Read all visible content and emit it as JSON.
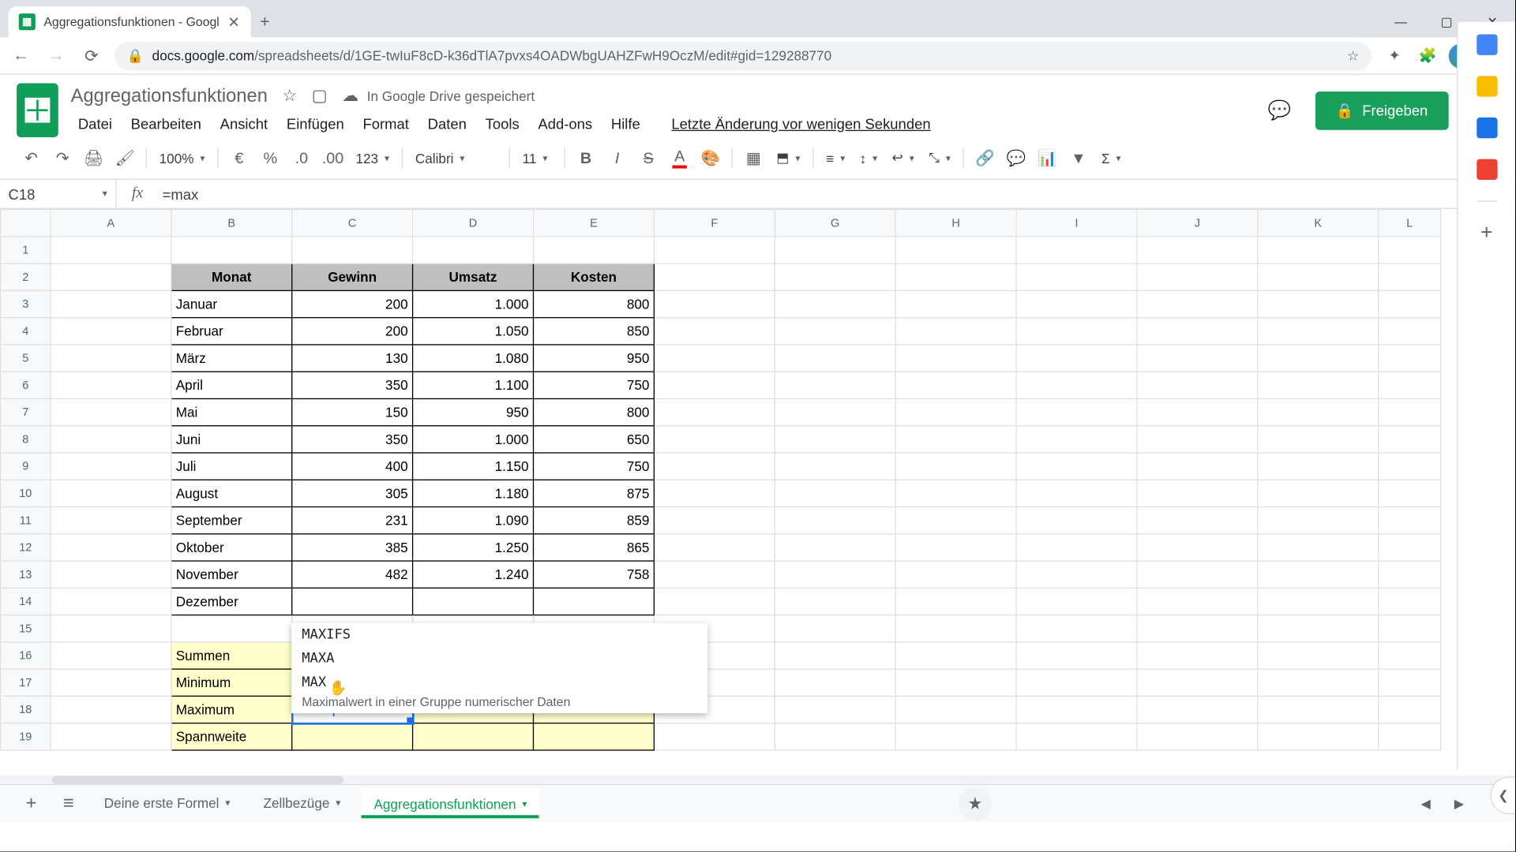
{
  "browser": {
    "tab_title": "Aggregationsfunktionen - Googl",
    "url_host": "docs.google.com",
    "url_path": "/spreadsheets/d/1GE-twIuF8cD-k36dTlA7pvxs4OADWbgUAHZFwH9OczM/edit#gid=129288770"
  },
  "doc": {
    "title": "Aggregationsfunktionen",
    "save_status": "In Google Drive gespeichert",
    "last_edit": "Letzte Änderung vor wenigen Sekunden",
    "share": "Freigeben"
  },
  "menus": [
    "Datei",
    "Bearbeiten",
    "Ansicht",
    "Einfügen",
    "Format",
    "Daten",
    "Tools",
    "Add-ons",
    "Hilfe"
  ],
  "toolbar": {
    "zoom": "100%",
    "font": "Calibri",
    "size": "11"
  },
  "namebox": "C18",
  "formula": "=max",
  "cols": [
    "A",
    "B",
    "C",
    "D",
    "E",
    "F",
    "G",
    "H",
    "I",
    "J",
    "K",
    "L"
  ],
  "rows": [
    1,
    2,
    3,
    4,
    5,
    6,
    7,
    8,
    9,
    10,
    11,
    12,
    13,
    14,
    15,
    16,
    17,
    18,
    19
  ],
  "header": {
    "b": "Monat",
    "c": "Gewinn",
    "d": "Umsatz",
    "e": "Kosten"
  },
  "data": [
    {
      "b": "Januar",
      "c": "200",
      "d": "1.000",
      "e": "800"
    },
    {
      "b": "Februar",
      "c": "200",
      "d": "1.050",
      "e": "850"
    },
    {
      "b": "März",
      "c": "130",
      "d": "1.080",
      "e": "950"
    },
    {
      "b": "April",
      "c": "350",
      "d": "1.100",
      "e": "750"
    },
    {
      "b": "Mai",
      "c": "150",
      "d": "950",
      "e": "800"
    },
    {
      "b": "Juni",
      "c": "350",
      "d": "1.000",
      "e": "650"
    },
    {
      "b": "Juli",
      "c": "400",
      "d": "1.150",
      "e": "750"
    },
    {
      "b": "August",
      "c": "305",
      "d": "1.180",
      "e": "875"
    },
    {
      "b": "September",
      "c": "231",
      "d": "1.090",
      "e": "859"
    },
    {
      "b": "Oktober",
      "c": "385",
      "d": "1.250",
      "e": "865"
    },
    {
      "b": "November",
      "c": "482",
      "d": "1.240",
      "e": "758"
    },
    {
      "b": "Dezember",
      "c": "",
      "d": "",
      "e": ""
    }
  ],
  "summary": [
    {
      "label": "Summen"
    },
    {
      "label": "Minimum"
    },
    {
      "label": "Maximum",
      "c": "=max"
    },
    {
      "label": "Spannweite"
    }
  ],
  "autocomplete": {
    "items": [
      "MAXIFS",
      "MAXA",
      "MAX"
    ],
    "desc": "Maximalwert in einer Gruppe numerischer Daten"
  },
  "cell_edit": "=max|",
  "sheet_tabs": [
    "Deine erste Formel",
    "Zellbezüge",
    "Aggregationsfunktionen"
  ]
}
